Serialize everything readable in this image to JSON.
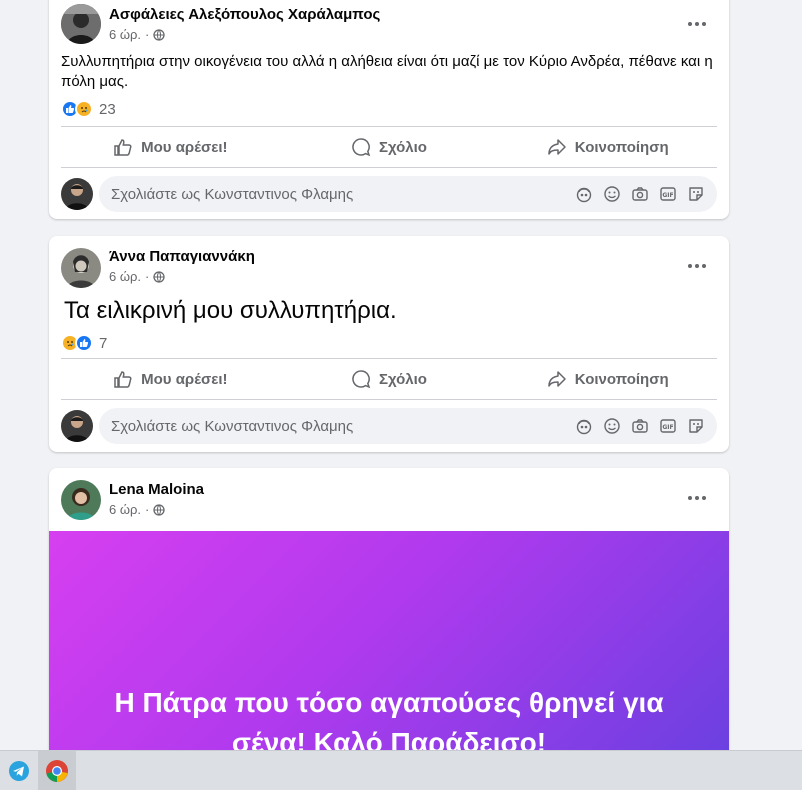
{
  "posts": [
    {
      "author": "Ασφάλειες Αλεξόπουλος Χαράλαμπος",
      "time": "6 ώρ.",
      "sep": "·",
      "text": "Συλλυπητήρια στην οικογένεια του αλλά η αλήθεια είναι ότι μαζί με τον Κύριο Ανδρέα, πέθανε και η πόλη μας.",
      "reaction_count": "23"
    },
    {
      "author": "Άννα Παπαγιαννάκη",
      "time": "6 ώρ.",
      "sep": "·",
      "text": "Τα ειλικρινή μου συλλυπητήρια.",
      "reaction_count": "7"
    },
    {
      "author": "Lena Maloina",
      "time": "6 ώρ.",
      "sep": "·",
      "banner_text": "Η Πάτρα που τόσο αγαπούσες θρηνεί για σένα! Καλό Παράδεισο!"
    }
  ],
  "actions": {
    "like": "Μου αρέσει!",
    "comment": "Σχόλιο",
    "share": "Κοινοποίηση"
  },
  "comment_placeholder": "Σχολιάστε ως Κωνσταντινος Φλαμης",
  "comment_icons": [
    "avatar-sticker-icon",
    "emoji-icon",
    "camera-icon",
    "gif-icon",
    "sticker-icon"
  ],
  "taskbar": {
    "apps": [
      "telegram-icon",
      "chrome-icon"
    ]
  },
  "colors": {
    "like_blue": "#1877f2",
    "text_grey": "#65676b",
    "banner_from": "#d63ff0",
    "banner_to": "#6a40e0"
  }
}
